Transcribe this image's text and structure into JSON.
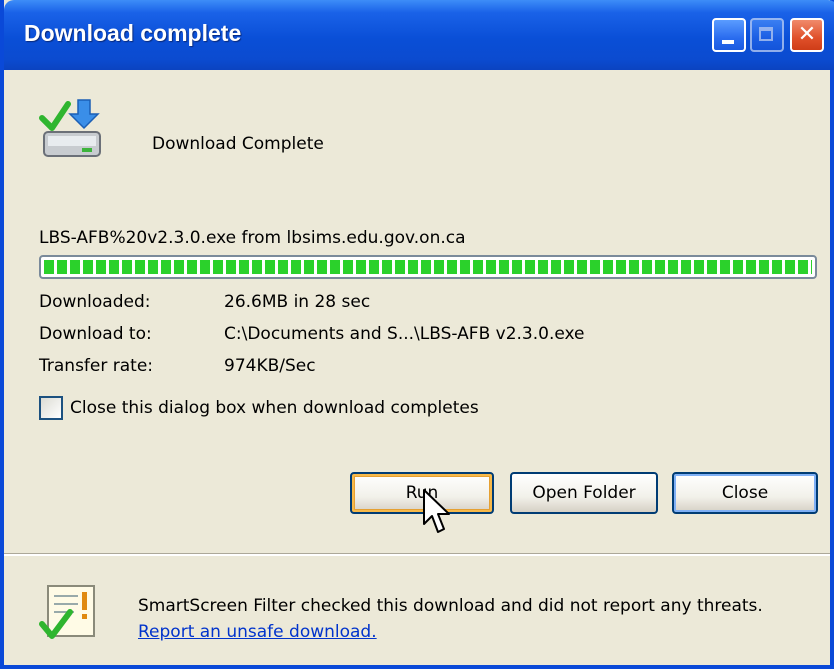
{
  "window": {
    "title": "Download complete"
  },
  "titlebar_buttons": {
    "minimize": "minimize-button",
    "maximize": "maximize-button",
    "close_glyph": "✕"
  },
  "header": {
    "text": "Download Complete",
    "icon": "download-complete-icon"
  },
  "download": {
    "source": "LBS-AFB%20v2.3.0.exe from lbsims.edu.gov.on.ca",
    "progress_percent": 100
  },
  "details": {
    "downloaded_label": "Downloaded:",
    "downloaded_value": "26.6MB in 28 sec",
    "download_to_label": "Download to:",
    "download_to_value": "C:\\Documents and S...\\LBS-AFB v2.3.0.exe",
    "transfer_rate_label": "Transfer rate:",
    "transfer_rate_value": "974KB/Sec"
  },
  "checkbox": {
    "label": "Close this dialog box when download completes",
    "checked": false
  },
  "buttons": {
    "run": "Run",
    "open_folder": "Open Folder",
    "close": "Close"
  },
  "smartscreen": {
    "text": "SmartScreen Filter checked this download and did not report any threats.",
    "link": "Report an unsafe download.",
    "icon": "smartscreen-check-icon"
  },
  "colors": {
    "titlebar": "#0a4fd7",
    "progress": "#2bd12b",
    "link": "#0033cc",
    "dialog_bg": "#ece9d8"
  }
}
